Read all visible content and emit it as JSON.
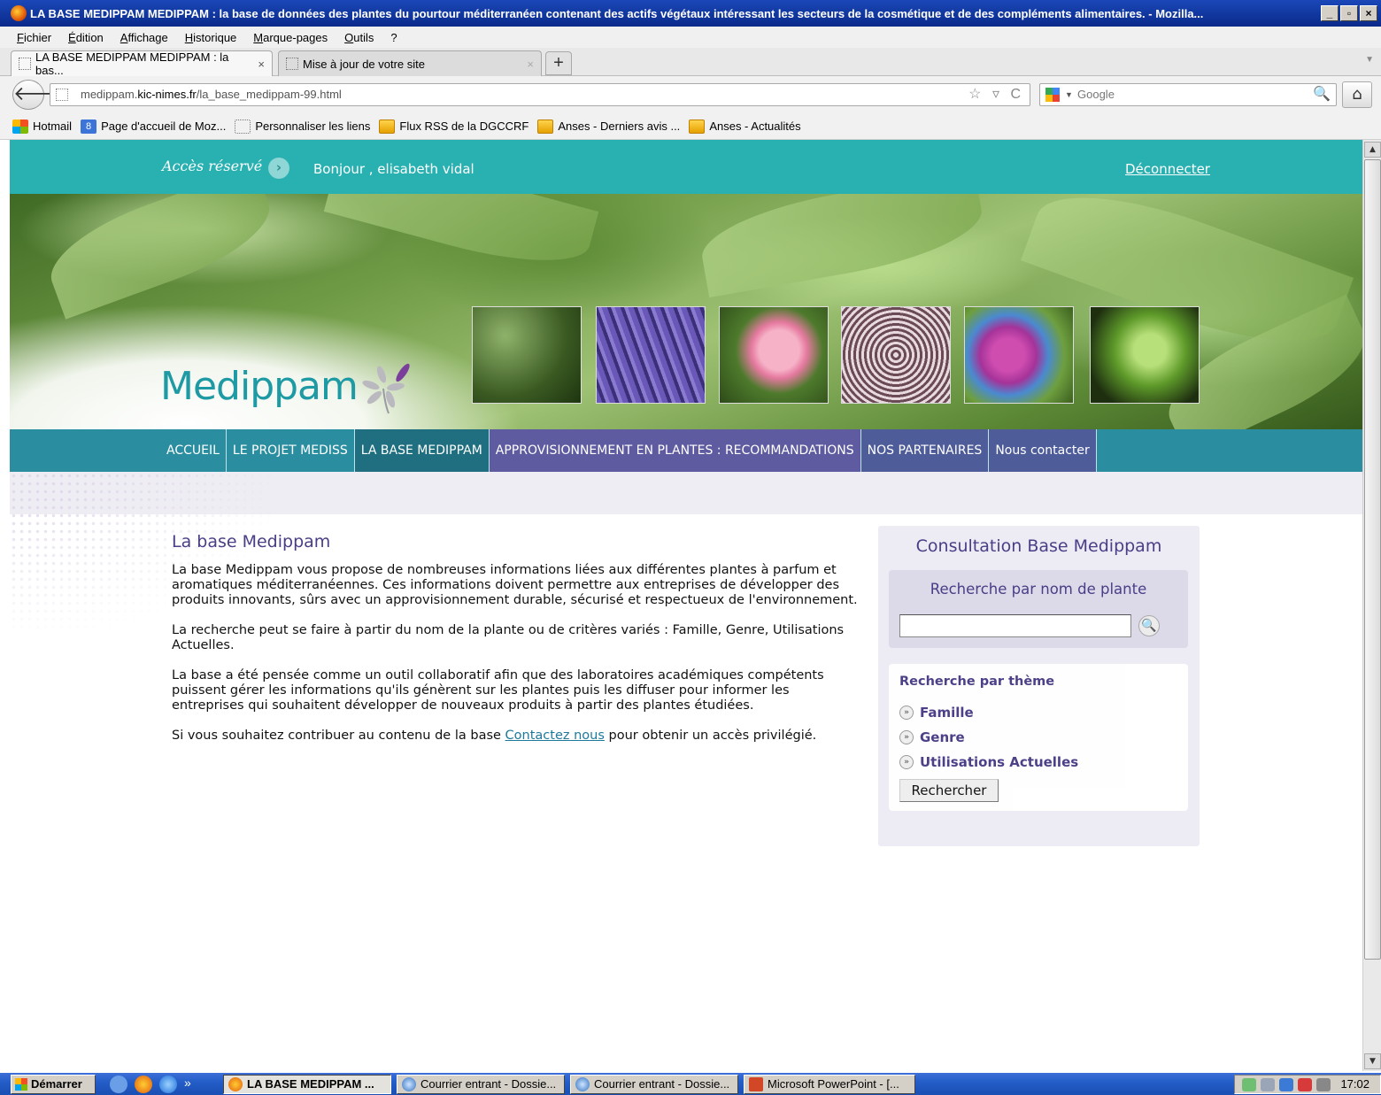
{
  "window": {
    "title": "LA BASE MEDIPPAM   MEDIPPAM : la base de données des plantes du pourtour méditerranéen contenant des actifs végétaux intéressant les secteurs de la cosmétique et de des compléments alimentaires. - Mozilla...",
    "minimize": "_",
    "restore": "▫",
    "close": "×"
  },
  "menu": {
    "items": [
      "Fichier",
      "Édition",
      "Affichage",
      "Historique",
      "Marque-pages",
      "Outils",
      "?"
    ]
  },
  "tabs": [
    {
      "label": "LA BASE MEDIPPAM   MEDIPPAM : la bas...",
      "active": true
    },
    {
      "label": "Mise à jour de votre site",
      "active": false
    }
  ],
  "tab_close_glyph": "×",
  "new_tab_glyph": "+",
  "tab_list_glyph": "▼",
  "nav": {
    "back_glyph": "🡐",
    "url_prefix": "medippam.",
    "url_domain": "kic-nimes.fr",
    "url_path": "/la_base_medippam-99.html",
    "url_icons": "☆ ▿ C",
    "search_placeholder": "Google",
    "search_drop_glyph": "▼",
    "search_glyph": "🔍",
    "home_glyph": "⌂"
  },
  "bookmarks": [
    {
      "label": "Hotmail",
      "icon": "windows-flag-icon"
    },
    {
      "label": "Page d'accueil de Moz...",
      "icon": "mozilla-icon"
    },
    {
      "label": "Personnaliser les liens",
      "icon": "blank-page-icon"
    },
    {
      "label": "Flux RSS de la DGCCRF",
      "icon": "rss-icon"
    },
    {
      "label": "Anses - Derniers avis ...",
      "icon": "rss-icon"
    },
    {
      "label": "Anses - Actualités",
      "icon": "rss-icon"
    }
  ],
  "bookmark_moz_glyph": "8",
  "site": {
    "topbar": {
      "acces": "Accès réservé",
      "arrow_glyph": "›",
      "greeting": "Bonjour , elisabeth vidal",
      "logout": "Déconnecter"
    },
    "logo_text": "Medippam",
    "main_nav": [
      {
        "label": "ACCUEIL"
      },
      {
        "label": "LE PROJET MEDISS"
      },
      {
        "label": "LA BASE MEDIPPAM"
      },
      {
        "label": "APPROVISIONNEMENT EN PLANTES : RECOMMANDATIONS"
      },
      {
        "label": "NOS PARTENAIRES"
      },
      {
        "label": "Nous contacter"
      }
    ],
    "content": {
      "title": "La base Medippam",
      "p1": "La base Medippam vous propose de nombreuses informations liées aux différentes plantes à parfum et aromatiques méditerranéennes. Ces informations doivent permettre aux entreprises de développer des produits innovants, sûrs avec un approvisionnement durable, sécurisé et respectueux de l'environnement.",
      "p2": "La recherche peut se faire à partir du nom de la plante ou de critères variés : Famille, Genre, Utilisations Actuelles.",
      "p3": "La base a été pensée comme un outil collaboratif afin que des laboratoires académiques compétents puissent gérer les informations qu'ils génèrent sur les plantes puis les diffuser pour informer les entreprises qui souhaitent développer de nouveaux produits à partir des plantes étudiées.",
      "p4_before": "Si vous souhaitez contribuer au contenu de la base ",
      "p4_link": "Contactez nous",
      "p4_after": " pour obtenir un accès privilégié."
    },
    "panel": {
      "title": "Consultation Base Medippam",
      "search_label": "Recherche par nom de plante",
      "search_value": "",
      "search_go_glyph": "🔍",
      "theme_label": "Recherche par thème",
      "theme_items": [
        "Famille",
        "Genre",
        "Utilisations Actuelles"
      ],
      "theme_item_glyph": "»",
      "submit": "Rechercher"
    }
  },
  "scrollbar": {
    "up_glyph": "▲",
    "down_glyph": "▼"
  },
  "taskbar": {
    "start": "Démarrer",
    "chevron": "»",
    "tasks": [
      {
        "label": "LA BASE MEDIPPAM  ...",
        "pressed": true
      },
      {
        "label": "Courrier entrant - Dossie...",
        "pressed": false
      },
      {
        "label": "Courrier entrant - Dossie...",
        "pressed": false
      },
      {
        "label": "Microsoft PowerPoint - [...",
        "pressed": false
      }
    ],
    "clock": "17:02"
  },
  "colors": {
    "teal_topbar": "#29b0b0",
    "nav_teal": "#2a8ea0",
    "nav_current": "#1f6f80",
    "heading_purple": "#4b3d86",
    "logo_teal": "#1d9aa3"
  }
}
